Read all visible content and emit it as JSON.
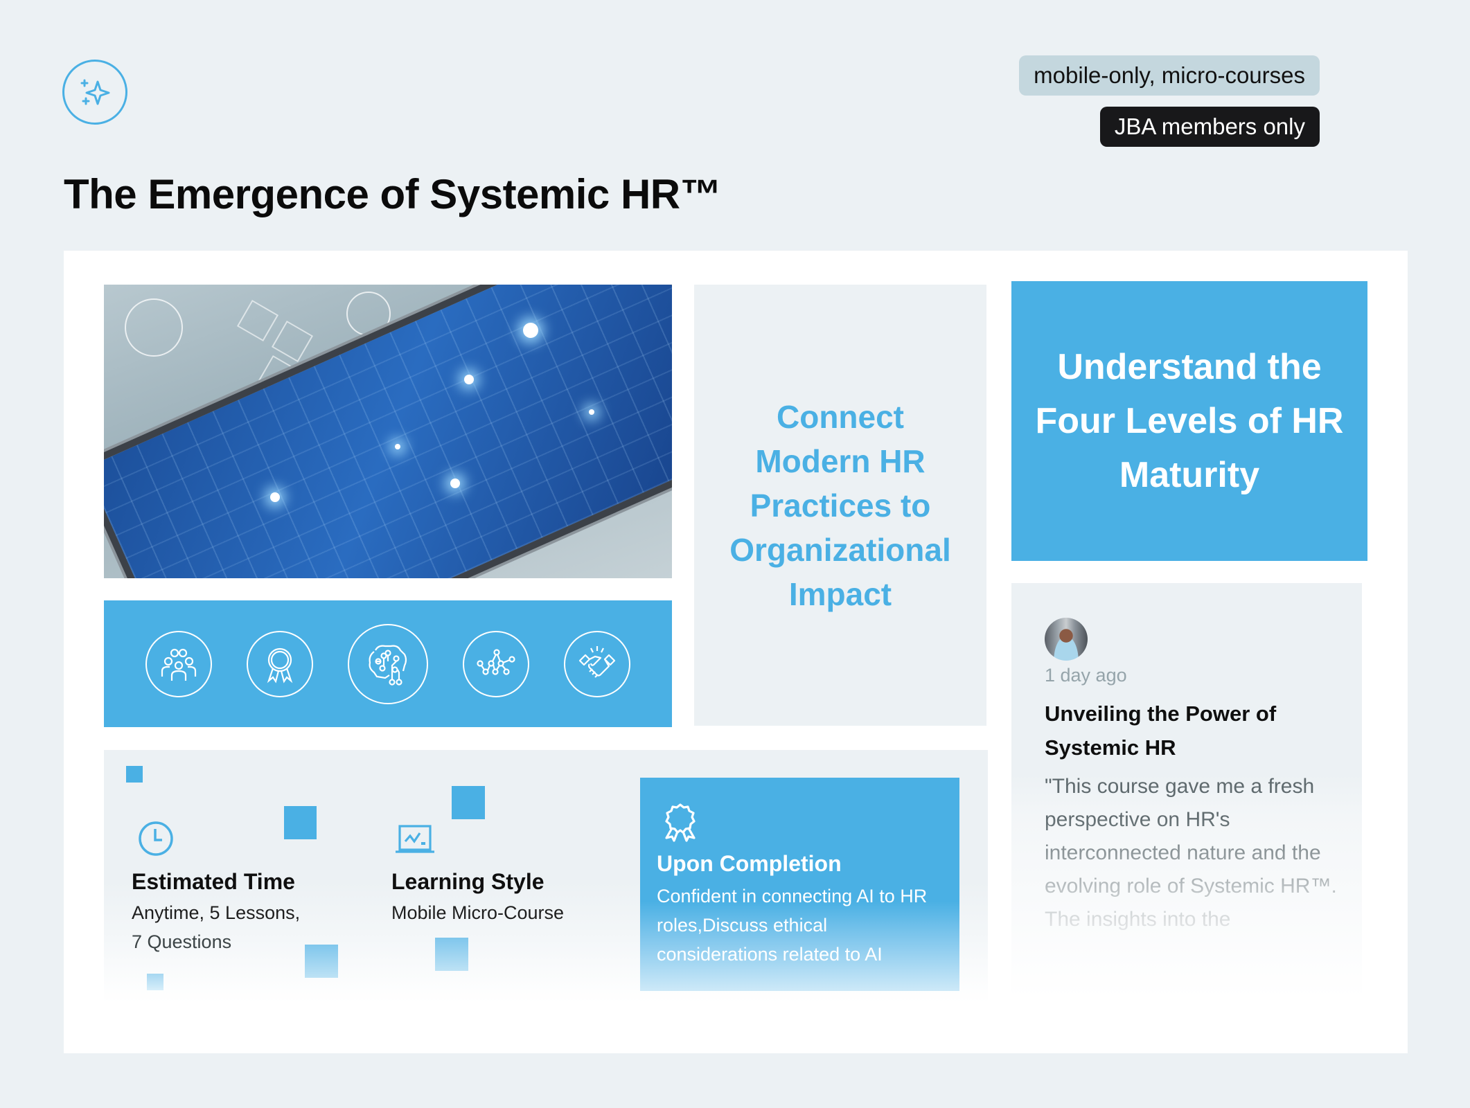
{
  "header": {
    "logo_icon": "sparkles-icon",
    "title": "The Emergence of Systemic HR™",
    "tags": [
      "mobile-only, micro-courses",
      "JBA members only"
    ]
  },
  "hero_image": {
    "description": "Smartphone with glowing blue circuit screen surrounded by holographic tech icons"
  },
  "icon_bar": {
    "icons": [
      "team-icon",
      "award-ribbon-icon",
      "ai-brain-circuit-icon",
      "network-graph-icon",
      "handshake-icon"
    ]
  },
  "objectives": {
    "primary": "Connect Modern HR Practices to Organizational Impact",
    "secondary": "Understand the Four Levels of HR Maturity"
  },
  "testimonial": {
    "time": "1 day ago",
    "heading": "Unveiling the Power of Systemic HR",
    "quote": "\"This course gave me a fresh perspective on HR's interconnected nature and the evolving role of Systemic HR™. The insights into the"
  },
  "details": {
    "estimated_time": {
      "icon": "clock-icon",
      "label": "Estimated Time",
      "value_line1": "Anytime, 5 Lessons,",
      "value_line2": "7 Questions"
    },
    "learning_style": {
      "icon": "laptop-chart-icon",
      "label": "Learning Style",
      "value": "Mobile Micro-Course"
    },
    "completion": {
      "icon": "award-ribbon-icon",
      "label": "Upon Completion",
      "value": "Confident in connecting AI to HR roles,Discuss ethical considerations related to AI"
    }
  },
  "colors": {
    "accent": "#4ab0e4",
    "background": "#ecf1f4",
    "tag_bg": "#c4d7de",
    "members_badge_bg": "#18181a"
  }
}
